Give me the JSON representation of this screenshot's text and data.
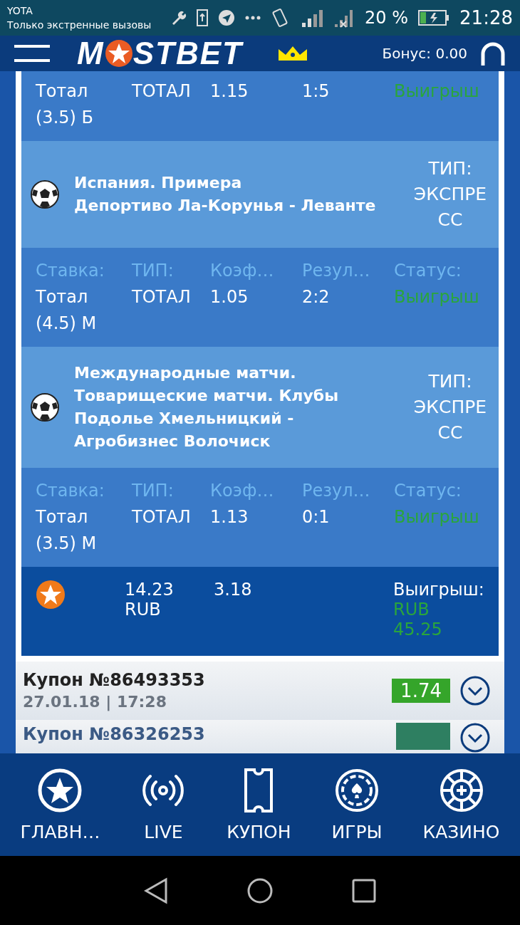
{
  "status_bar": {
    "carrier": "YOTA",
    "notice": "Только экстренные вызовы",
    "battery": "20 %",
    "time": "21:28"
  },
  "header": {
    "logo_left": "M",
    "logo_right": "STBET",
    "bonus": "Бонус: 0.00"
  },
  "bet_list": [
    {
      "kind": "bet",
      "values": [
        "Тотал (3.5) Б",
        "ТОТАЛ",
        "1.15",
        "1:5",
        "Выигрыш"
      ]
    },
    {
      "kind": "event",
      "lines": [
        "Испания. Примера",
        "Депортиво Ла-Корунья - Леванте"
      ],
      "type_label": "ТИП:",
      "type": "ЭКСПРЕСС"
    },
    {
      "kind": "bet",
      "labels": [
        "Ставка:",
        "ТИП:",
        "Коэф…",
        "Резул…",
        "Статус:"
      ],
      "values": [
        "Тотал (4.5) М",
        "ТОТАЛ",
        "1.05",
        "2:2",
        "Выигрыш"
      ]
    },
    {
      "kind": "event",
      "lines": [
        "Международные матчи.",
        "Товарищеские матчи. Клубы",
        "Подолье Хмельницкий -",
        "Агробизнес Волочиск"
      ],
      "type_label": "ТИП:",
      "type": "ЭКСПРЕСС"
    },
    {
      "kind": "bet",
      "labels": [
        "Ставка:",
        "ТИП:",
        "Коэф…",
        "Резул…",
        "Статус:"
      ],
      "values": [
        "Тотал (3.5) М",
        "ТОТАЛ",
        "1.13",
        "0:1",
        "Выигрыш"
      ]
    },
    {
      "kind": "summary",
      "stake": "14.23 RUB",
      "odds": "3.18",
      "win_label": "Выигрыш:",
      "win": "RUB 45.25"
    }
  ],
  "coupons": [
    {
      "title": "Купон №86493353",
      "date": "27.01.18 | 17:28",
      "odds": "1.74"
    },
    {
      "title": "Купон №86326253"
    }
  ],
  "bottom_nav": [
    {
      "label": "ГЛАВН…"
    },
    {
      "label": "LIVE"
    },
    {
      "label": "КУПОН"
    },
    {
      "label": "ИГРЫ"
    },
    {
      "label": "КАЗИНО"
    }
  ]
}
